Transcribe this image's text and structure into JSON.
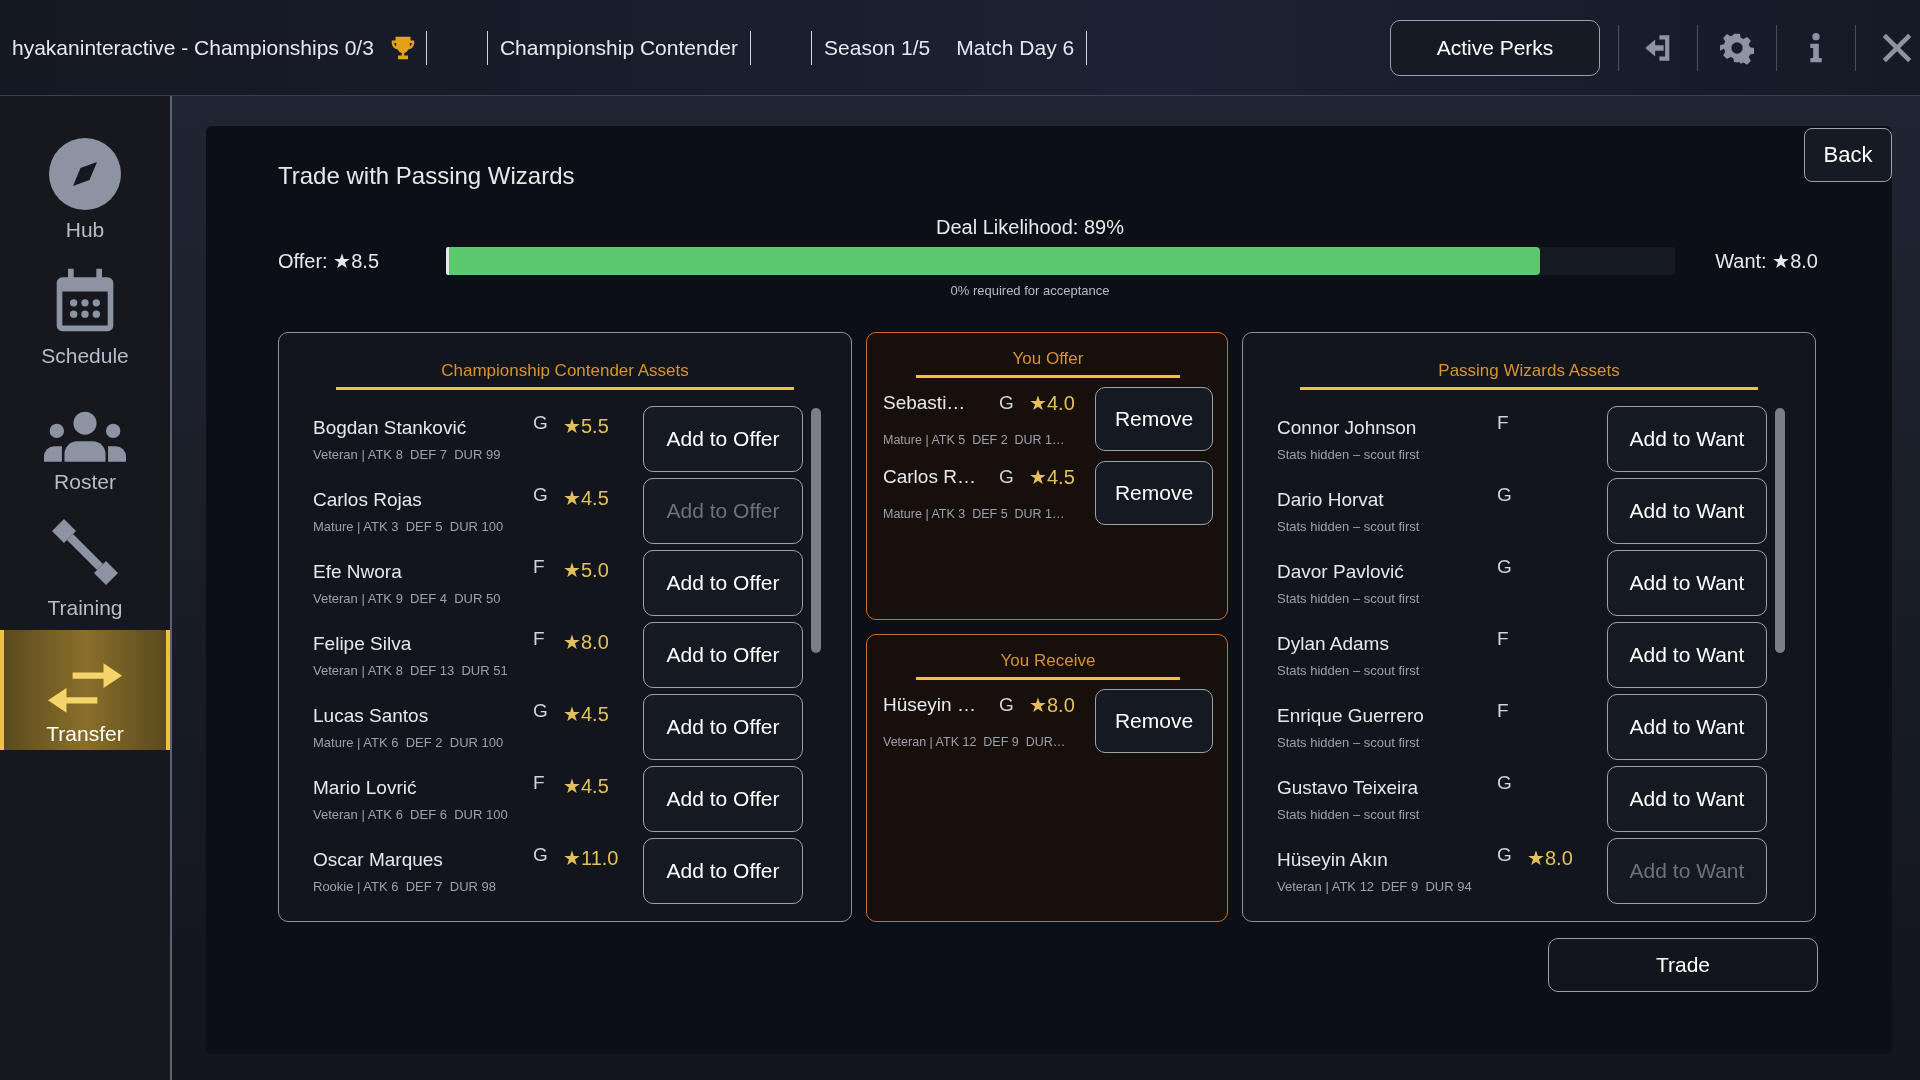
{
  "top_bar": {
    "title": "hyakaninteractive - Championships 0/3",
    "team": "Championship Contender",
    "season": "Season 1/5",
    "match_day": "Match Day 6",
    "perks_button": "Active Perks"
  },
  "sidebar": {
    "items": [
      {
        "label": "Hub",
        "selected": false
      },
      {
        "label": "Schedule",
        "selected": false
      },
      {
        "label": "Roster",
        "selected": false
      },
      {
        "label": "Training",
        "selected": false
      },
      {
        "label": "Transfer",
        "selected": true
      }
    ]
  },
  "modal": {
    "title": "Trade with Passing Wizards",
    "back_button": "Back",
    "deal_label": "Deal Likelihood: 89%",
    "offer_total": "Offer: ★8.5",
    "want_total": "Want: ★8.0",
    "deal_meter": {
      "level": 0.89
    },
    "requirement": "0% required for acceptance",
    "trade_button": "Trade",
    "my_assets": {
      "heading": "Championship Contender Assets",
      "rows": [
        {
          "name": "Bogdan Stanković",
          "position": "G",
          "rating": "★5.5",
          "stats": "Veteran | ATK 8  DEF 7  DUR 99",
          "button": "Add to Offer",
          "disabled": false
        },
        {
          "name": "Carlos Rojas",
          "position": "G",
          "rating": "★4.5",
          "stats": "Mature | ATK 3  DEF 5  DUR 100",
          "button": "Add to Offer",
          "disabled": true
        },
        {
          "name": "Efe Nwora",
          "position": "F",
          "rating": "★5.0",
          "stats": "Veteran | ATK 9  DEF 4  DUR 50",
          "button": "Add to Offer",
          "disabled": false
        },
        {
          "name": "Felipe Silva",
          "position": "F",
          "rating": "★8.0",
          "stats": "Veteran | ATK 8  DEF 13  DUR 51",
          "button": "Add to Offer",
          "disabled": false
        },
        {
          "name": "Lucas Santos",
          "position": "G",
          "rating": "★4.5",
          "stats": "Mature | ATK 6  DEF 2  DUR 100",
          "button": "Add to Offer",
          "disabled": false
        },
        {
          "name": "Mario Lovrić",
          "position": "F",
          "rating": "★4.5",
          "stats": "Veteran | ATK 6  DEF 6  DUR 100",
          "button": "Add to Offer",
          "disabled": false
        },
        {
          "name": "Oscar Marques",
          "position": "G",
          "rating": "★11.0",
          "stats": "Rookie | ATK 6  DEF 7  DUR 98",
          "button": "Add to Offer",
          "disabled": false
        }
      ]
    },
    "you_offer": {
      "heading": "You Offer",
      "rows": [
        {
          "name": "Sebasti…",
          "position": "G",
          "rating": "★4.0",
          "stats": "Mature | ATK 5  DEF 2  DUR 1…",
          "button": "Remove"
        },
        {
          "name": "Carlos R…",
          "position": "G",
          "rating": "★4.5",
          "stats": "Mature | ATK 3  DEF 5  DUR 1…",
          "button": "Remove"
        }
      ]
    },
    "you_receive": {
      "heading": "You Receive",
      "rows": [
        {
          "name": "Hüseyin …",
          "position": "G",
          "rating": "★8.0",
          "stats": "Veteran | ATK 12  DEF 9  DUR…",
          "button": "Remove"
        }
      ]
    },
    "their_assets": {
      "heading": "Passing Wizards Assets",
      "rows": [
        {
          "name": "Connor Johnson",
          "position": "F",
          "stats": "Stats hidden – scout first",
          "button": "Add to Want",
          "disabled": false
        },
        {
          "name": "Dario Horvat",
          "position": "G",
          "stats": "Stats hidden – scout first",
          "button": "Add to Want",
          "disabled": false
        },
        {
          "name": "Davor Pavlović",
          "position": "G",
          "stats": "Stats hidden – scout first",
          "button": "Add to Want",
          "disabled": false
        },
        {
          "name": "Dylan Adams",
          "position": "F",
          "stats": "Stats hidden – scout first",
          "button": "Add to Want",
          "disabled": false
        },
        {
          "name": "Enrique Guerrero",
          "position": "F",
          "stats": "Stats hidden – scout first",
          "button": "Add to Want",
          "disabled": false
        },
        {
          "name": "Gustavo Teixeira",
          "position": "G",
          "stats": "Stats hidden – scout first",
          "button": "Add to Want",
          "disabled": false
        },
        {
          "name": "Hüseyin Akın",
          "position": "G",
          "rating": "★8.0",
          "stats": "Veteran | ATK 12  DEF 9  DUR 94",
          "button": "Add to Want",
          "disabled": true
        }
      ]
    }
  }
}
